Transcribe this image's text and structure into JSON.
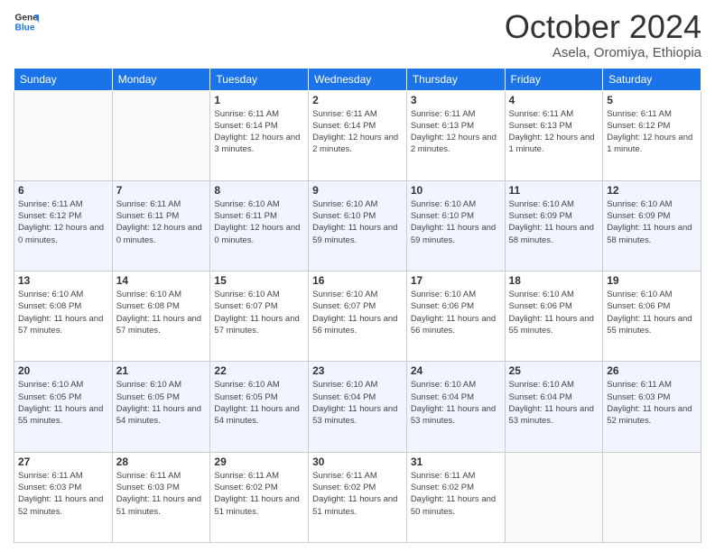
{
  "header": {
    "logo_line1": "General",
    "logo_line2": "Blue",
    "month": "October 2024",
    "location": "Asela, Oromiya, Ethiopia"
  },
  "weekdays": [
    "Sunday",
    "Monday",
    "Tuesday",
    "Wednesday",
    "Thursday",
    "Friday",
    "Saturday"
  ],
  "weeks": [
    [
      {
        "day": "",
        "info": ""
      },
      {
        "day": "",
        "info": ""
      },
      {
        "day": "1",
        "info": "Sunrise: 6:11 AM\nSunset: 6:14 PM\nDaylight: 12 hours and 3 minutes."
      },
      {
        "day": "2",
        "info": "Sunrise: 6:11 AM\nSunset: 6:14 PM\nDaylight: 12 hours and 2 minutes."
      },
      {
        "day": "3",
        "info": "Sunrise: 6:11 AM\nSunset: 6:13 PM\nDaylight: 12 hours and 2 minutes."
      },
      {
        "day": "4",
        "info": "Sunrise: 6:11 AM\nSunset: 6:13 PM\nDaylight: 12 hours and 1 minute."
      },
      {
        "day": "5",
        "info": "Sunrise: 6:11 AM\nSunset: 6:12 PM\nDaylight: 12 hours and 1 minute."
      }
    ],
    [
      {
        "day": "6",
        "info": "Sunrise: 6:11 AM\nSunset: 6:12 PM\nDaylight: 12 hours and 0 minutes."
      },
      {
        "day": "7",
        "info": "Sunrise: 6:11 AM\nSunset: 6:11 PM\nDaylight: 12 hours and 0 minutes."
      },
      {
        "day": "8",
        "info": "Sunrise: 6:10 AM\nSunset: 6:11 PM\nDaylight: 12 hours and 0 minutes."
      },
      {
        "day": "9",
        "info": "Sunrise: 6:10 AM\nSunset: 6:10 PM\nDaylight: 11 hours and 59 minutes."
      },
      {
        "day": "10",
        "info": "Sunrise: 6:10 AM\nSunset: 6:10 PM\nDaylight: 11 hours and 59 minutes."
      },
      {
        "day": "11",
        "info": "Sunrise: 6:10 AM\nSunset: 6:09 PM\nDaylight: 11 hours and 58 minutes."
      },
      {
        "day": "12",
        "info": "Sunrise: 6:10 AM\nSunset: 6:09 PM\nDaylight: 11 hours and 58 minutes."
      }
    ],
    [
      {
        "day": "13",
        "info": "Sunrise: 6:10 AM\nSunset: 6:08 PM\nDaylight: 11 hours and 57 minutes."
      },
      {
        "day": "14",
        "info": "Sunrise: 6:10 AM\nSunset: 6:08 PM\nDaylight: 11 hours and 57 minutes."
      },
      {
        "day": "15",
        "info": "Sunrise: 6:10 AM\nSunset: 6:07 PM\nDaylight: 11 hours and 57 minutes."
      },
      {
        "day": "16",
        "info": "Sunrise: 6:10 AM\nSunset: 6:07 PM\nDaylight: 11 hours and 56 minutes."
      },
      {
        "day": "17",
        "info": "Sunrise: 6:10 AM\nSunset: 6:06 PM\nDaylight: 11 hours and 56 minutes."
      },
      {
        "day": "18",
        "info": "Sunrise: 6:10 AM\nSunset: 6:06 PM\nDaylight: 11 hours and 55 minutes."
      },
      {
        "day": "19",
        "info": "Sunrise: 6:10 AM\nSunset: 6:06 PM\nDaylight: 11 hours and 55 minutes."
      }
    ],
    [
      {
        "day": "20",
        "info": "Sunrise: 6:10 AM\nSunset: 6:05 PM\nDaylight: 11 hours and 55 minutes."
      },
      {
        "day": "21",
        "info": "Sunrise: 6:10 AM\nSunset: 6:05 PM\nDaylight: 11 hours and 54 minutes."
      },
      {
        "day": "22",
        "info": "Sunrise: 6:10 AM\nSunset: 6:05 PM\nDaylight: 11 hours and 54 minutes."
      },
      {
        "day": "23",
        "info": "Sunrise: 6:10 AM\nSunset: 6:04 PM\nDaylight: 11 hours and 53 minutes."
      },
      {
        "day": "24",
        "info": "Sunrise: 6:10 AM\nSunset: 6:04 PM\nDaylight: 11 hours and 53 minutes."
      },
      {
        "day": "25",
        "info": "Sunrise: 6:10 AM\nSunset: 6:04 PM\nDaylight: 11 hours and 53 minutes."
      },
      {
        "day": "26",
        "info": "Sunrise: 6:11 AM\nSunset: 6:03 PM\nDaylight: 11 hours and 52 minutes."
      }
    ],
    [
      {
        "day": "27",
        "info": "Sunrise: 6:11 AM\nSunset: 6:03 PM\nDaylight: 11 hours and 52 minutes."
      },
      {
        "day": "28",
        "info": "Sunrise: 6:11 AM\nSunset: 6:03 PM\nDaylight: 11 hours and 51 minutes."
      },
      {
        "day": "29",
        "info": "Sunrise: 6:11 AM\nSunset: 6:02 PM\nDaylight: 11 hours and 51 minutes."
      },
      {
        "day": "30",
        "info": "Sunrise: 6:11 AM\nSunset: 6:02 PM\nDaylight: 11 hours and 51 minutes."
      },
      {
        "day": "31",
        "info": "Sunrise: 6:11 AM\nSunset: 6:02 PM\nDaylight: 11 hours and 50 minutes."
      },
      {
        "day": "",
        "info": ""
      },
      {
        "day": "",
        "info": ""
      }
    ]
  ]
}
